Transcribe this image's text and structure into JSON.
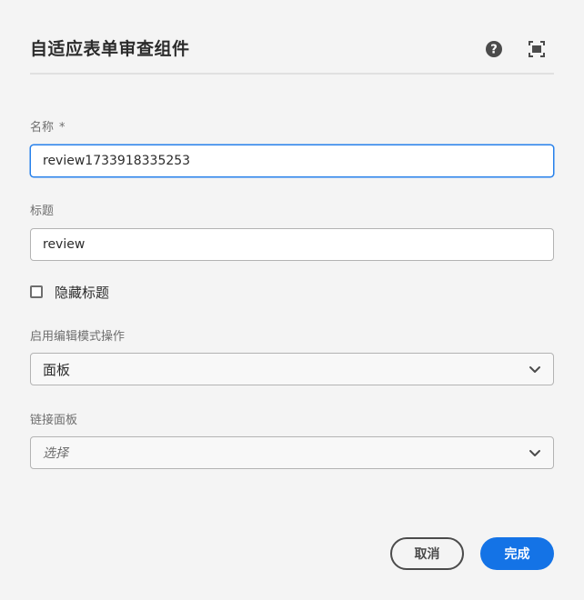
{
  "dialog": {
    "title": "自适应表单审查组件",
    "icons": {
      "help": "help-icon",
      "fullscreen": "fullscreen-icon"
    }
  },
  "fields": {
    "name": {
      "label": "名称",
      "required_marker": "*",
      "value": "review1733918335253"
    },
    "title": {
      "label": "标题",
      "value": "review"
    },
    "hide_title": {
      "label": "隐藏标题",
      "checked": false
    },
    "edit_mode_action": {
      "label": "启用编辑模式操作",
      "selected": "面板"
    },
    "linked_panels": {
      "label": "链接面板",
      "placeholder": "选择"
    }
  },
  "actions": {
    "cancel_label": "取消",
    "done_label": "完成"
  },
  "colors": {
    "accent": "#1473e6",
    "focus": "#2680eb",
    "background": "#f4f4f4"
  }
}
